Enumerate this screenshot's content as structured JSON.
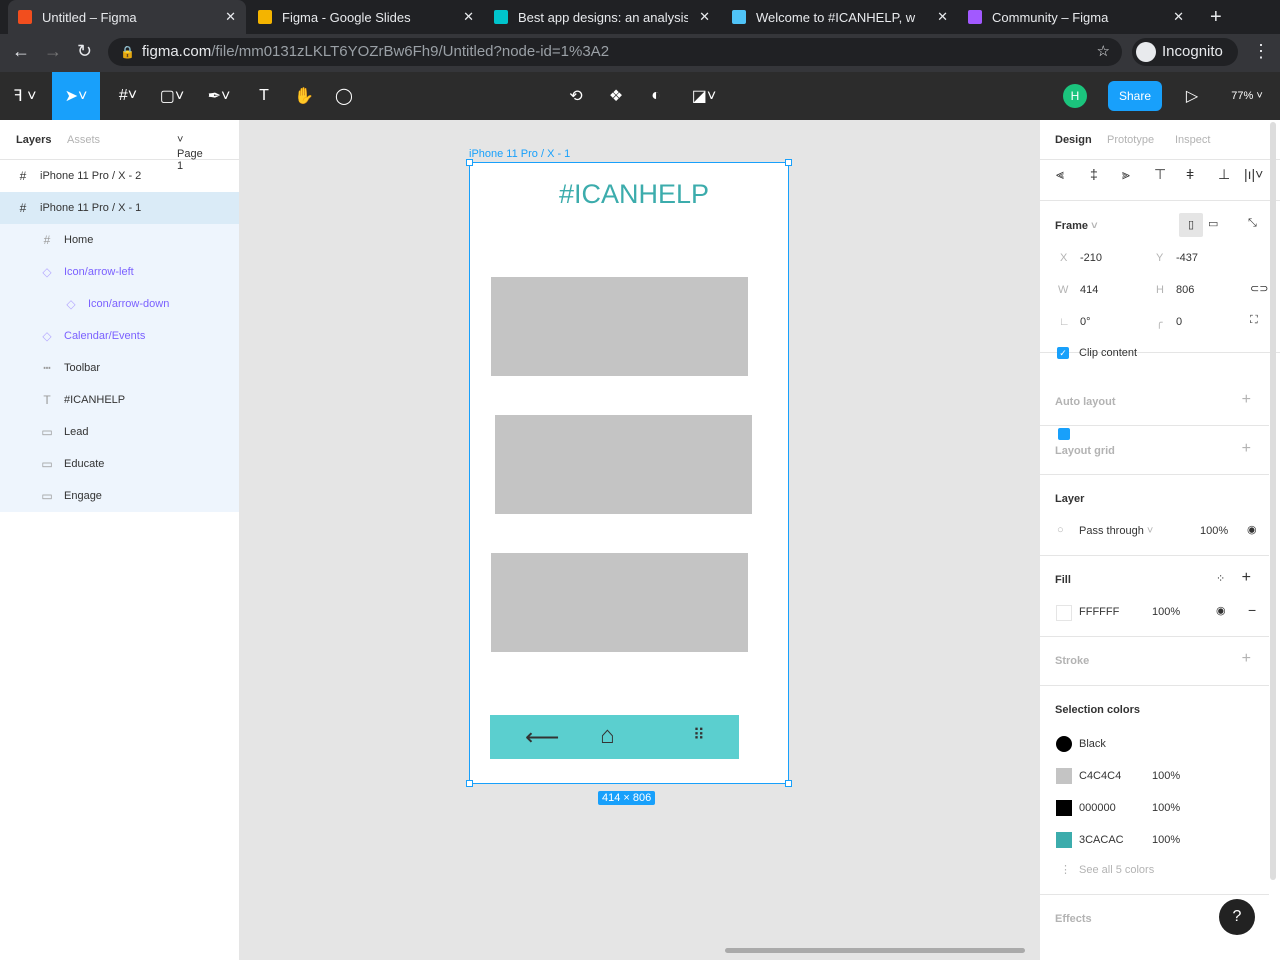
{
  "browser": {
    "tabs": [
      {
        "title": "Untitled – Figma",
        "color": "#f24e1e",
        "active": true
      },
      {
        "title": "Figma - Google Slides",
        "color": "#f4b400"
      },
      {
        "title": "Best app designs: an analysis",
        "color": "#00c4cc"
      },
      {
        "title": "Welcome to #ICANHELP, w",
        "color": "#4fc3f7"
      },
      {
        "title": "Community – Figma",
        "color": "#a259ff"
      }
    ],
    "url_host": "figma.com",
    "url_path": "/file/mm0131zLKLT6YOZrBw6Fh9/Untitled?node-id=1%3A2",
    "incognito": "Incognito"
  },
  "toolbar": {
    "share": "Share",
    "zoom": "77%",
    "avatar": "H"
  },
  "left": {
    "tab_layers": "Layers",
    "tab_assets": "Assets",
    "page": "Page 1",
    "layers": [
      {
        "name": "iPhone 11 Pro / X - 2",
        "icon": "#",
        "type": "frame"
      },
      {
        "name": "iPhone 11 Pro / X - 1",
        "icon": "#",
        "type": "frame-selected"
      },
      {
        "name": "Home",
        "icon": "#",
        "type": "child"
      },
      {
        "name": "Icon/arrow-left",
        "icon": "◇",
        "type": "comp"
      },
      {
        "name": "Icon/arrow-down",
        "icon": "◇",
        "type": "comp2"
      },
      {
        "name": "Calendar/Events",
        "icon": "◇",
        "type": "comp"
      },
      {
        "name": "Toolbar",
        "icon": "┅",
        "type": "child"
      },
      {
        "name": "#ICANHELP",
        "icon": "T",
        "type": "child"
      },
      {
        "name": "Lead",
        "icon": "▭",
        "type": "child"
      },
      {
        "name": "Educate",
        "icon": "▭",
        "type": "child"
      },
      {
        "name": "Engage",
        "icon": "▭",
        "type": "child"
      }
    ]
  },
  "canvas": {
    "frame_label": "iPhone 11 Pro / X - 1",
    "title": "#ICANHELP",
    "size": "414 × 806"
  },
  "right": {
    "tabs": [
      "Design",
      "Prototype",
      "Inspect"
    ],
    "frame": "Frame",
    "x": "-210",
    "y": "-437",
    "w": "414",
    "h": "806",
    "rotation": "0°",
    "radius": "0",
    "clip": "Clip content",
    "auto_layout": "Auto layout",
    "layout_grid": "Layout grid",
    "layer": "Layer",
    "blend": "Pass through",
    "opacity": "100%",
    "fill": "Fill",
    "fill_hex": "FFFFFF",
    "fill_opacity": "100%",
    "stroke": "Stroke",
    "selection_colors": "Selection colors",
    "colors": [
      {
        "name": "Black",
        "pct": "",
        "hex": "#000000",
        "round": true
      },
      {
        "name": "C4C4C4",
        "pct": "100%",
        "hex": "#c4c4c4"
      },
      {
        "name": "000000",
        "pct": "100%",
        "hex": "#000000"
      },
      {
        "name": "3CACAC",
        "pct": "100%",
        "hex": "#3cacac"
      }
    ],
    "see_all": "See all 5 colors",
    "effects": "Effects"
  }
}
